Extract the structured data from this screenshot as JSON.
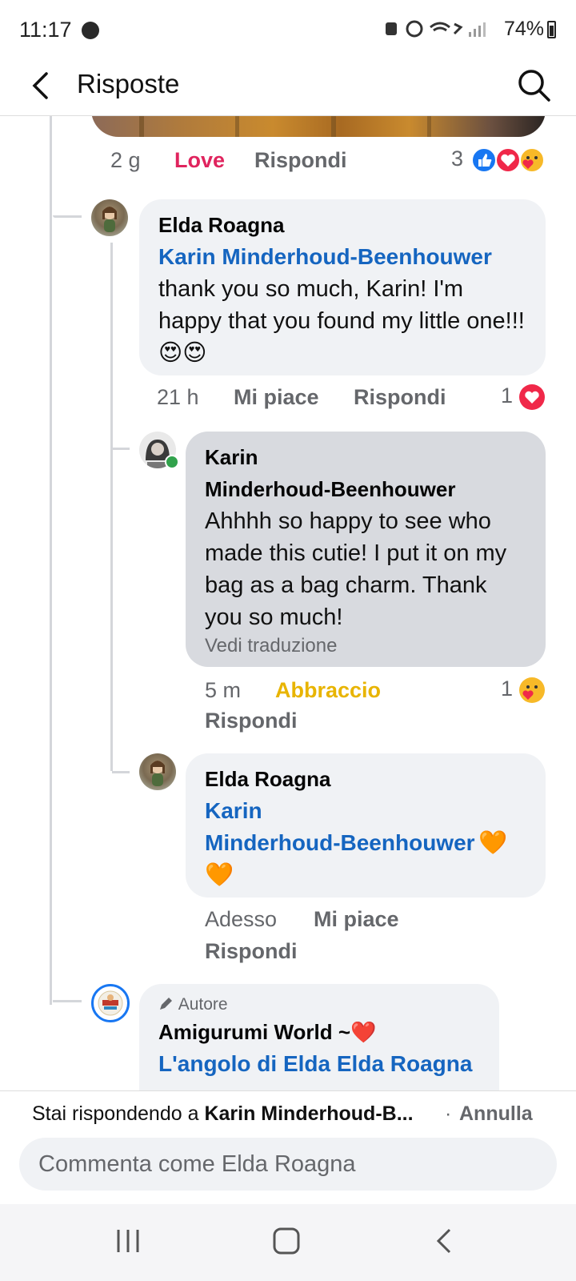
{
  "status_bar": {
    "time": "11:17",
    "battery": "74%"
  },
  "header": {
    "title": "Risposte"
  },
  "top_reply": {
    "time": "2 g",
    "reaction": "Love",
    "reply": "Rispondi",
    "reaction_count": "3",
    "reaction_icons": [
      "like-icon",
      "love-icon",
      "care-icon"
    ]
  },
  "comments": [
    {
      "author": "Elda Roagna",
      "mention": "Karin Minderhoud-Beenhouwer",
      "text": "thank you so much, Karin! I'm happy that you found my little one!!! 😍😍",
      "time": "21 h",
      "like": "Mi piace",
      "reply": "Rispondi",
      "reaction_count": "1",
      "reaction_icon": "love-icon"
    },
    {
      "author_line1": "Karin",
      "author_line2": "Minderhoud-Beenhouwer",
      "text": "Ahhhh so happy to see who made this cutie! I put it on my bag as a bag charm. Thank you so much!",
      "translate": "Vedi traduzione",
      "time": "5 m",
      "reaction": "Abbraccio",
      "reply": "Rispondi",
      "reaction_count": "1",
      "reaction_icon": "care-icon"
    },
    {
      "author": "Elda Roagna",
      "mention_line1": "Karin",
      "mention_line2": "Minderhoud-Beenhouwer",
      "emoji": "🧡",
      "emoji2": "🧡",
      "time": "Adesso",
      "like": "Mi piace",
      "reply": "Rispondi"
    },
    {
      "badge": "Autore",
      "author": "Amigurumi World ~❤️",
      "mention": "L'angolo di Elda Elda Roagna"
    }
  ],
  "reply_bar": {
    "replying_prefix": "Stai rispondendo a ",
    "replying_to": "Karin Minderhoud-B...",
    "separator": " · ",
    "cancel": "Annulla",
    "placeholder": "Commenta come Elda Roagna"
  },
  "colors": {
    "mention": "#1565c0",
    "love": "#e0245e",
    "care": "#f7b928",
    "bubble": "#f0f2f5",
    "bubble_active": "#d8dadf"
  }
}
